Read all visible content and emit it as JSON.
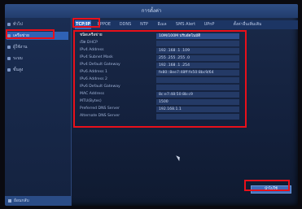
{
  "window": {
    "title": "การตั้งค่า"
  },
  "sidebar": {
    "items": [
      {
        "label": "ทั่วไป",
        "icon": "gear-icon"
      },
      {
        "label": "เครือข่าย",
        "icon": "network-icon",
        "active": true
      },
      {
        "label": "ผู้ใช้งาน",
        "icon": "user-icon"
      },
      {
        "label": "ระบบ",
        "icon": "system-icon"
      },
      {
        "label": "ขั้นสูง",
        "icon": "advanced-icon"
      }
    ],
    "bottom": {
      "label": "ย้อนกลับ",
      "icon": "back-icon"
    }
  },
  "tabs": [
    {
      "label": "TCP/IP",
      "active": true
    },
    {
      "label": "PPPOE"
    },
    {
      "label": "DDNS"
    },
    {
      "label": "NTP"
    },
    {
      "label": "อีเมล"
    },
    {
      "label": "SMS Alert"
    },
    {
      "label": "UPnP"
    },
    {
      "label": "ตั้งค่าอื่นเพิ่มเติม"
    }
  ],
  "form": {
    "rows": [
      {
        "label": "ชนิดเครือข่าย",
        "value": "10M/100M ปรับอัตโนมัติ",
        "active": true
      },
      {
        "label": "เปิด DHCP",
        "value": ""
      },
      {
        "label": "IPv4 Address",
        "value": "192 .168 .1 .109"
      },
      {
        "label": "IPv4 Subnet Mask",
        "value": "255 .255 .255 .0"
      },
      {
        "label": "IPv4 Default Gateway",
        "value": "192 .168 .1 .254"
      },
      {
        "label": "IPv6 Address 1",
        "value": "fe80::8ee7:48ff:fe50:8bc9/64"
      },
      {
        "label": "IPv6 Address 2",
        "value": ""
      },
      {
        "label": "IPv6 Default Gateway",
        "value": ""
      },
      {
        "label": "MAC Address",
        "value": "8c:e7:48:50:8b:c9"
      },
      {
        "label": "MTU(Bytes)",
        "value": "1500"
      },
      {
        "label": "Preferred DNS Server",
        "value": "192.168.1.1"
      },
      {
        "label": "Alternate DNS Server",
        "value": ""
      }
    ]
  },
  "footer": {
    "apply_label": "นำไปใช้"
  },
  "colors": {
    "highlight": "#e8101a",
    "active_blue": "#3569bd"
  }
}
